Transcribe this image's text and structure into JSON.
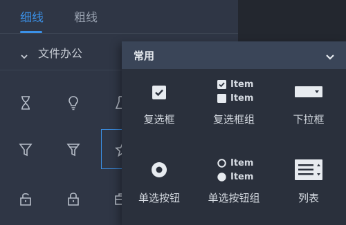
{
  "tabs": [
    {
      "label": "细线",
      "active": true
    },
    {
      "label": "粗线",
      "active": false
    }
  ],
  "section": {
    "label": "文件办公",
    "expanded": true
  },
  "icons": [
    {
      "name": "hourglass-icon"
    },
    {
      "name": "lightbulb-icon"
    },
    {
      "name": "flask-icon"
    },
    {
      "name": "funnel-icon"
    },
    {
      "name": "funnel-filled-icon"
    },
    {
      "name": "star-icon"
    },
    {
      "name": "unlock-icon"
    },
    {
      "name": "lock-icon"
    },
    {
      "name": "briefcase-icon"
    }
  ],
  "popup": {
    "title": "常用",
    "items": [
      {
        "label": "复选框",
        "icon": "checkbox-icon"
      },
      {
        "label": "复选框组",
        "icon": "checkbox-group-icon",
        "options": [
          "Item",
          "Item"
        ]
      },
      {
        "label": "下拉框",
        "icon": "dropdown-icon"
      },
      {
        "label": "单选按钮",
        "icon": "radio-icon"
      },
      {
        "label": "单选按钮组",
        "icon": "radio-group-icon",
        "options": [
          "Item",
          "Item"
        ]
      },
      {
        "label": "列表",
        "icon": "list-icon"
      }
    ]
  },
  "colors": {
    "accent": "#3b91e8",
    "panel": "#2f3645",
    "popup_header": "#3a4558"
  }
}
